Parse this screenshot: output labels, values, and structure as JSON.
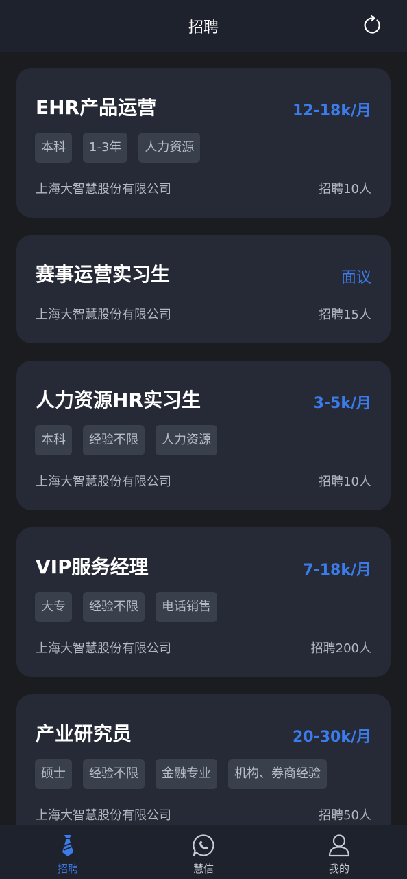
{
  "header": {
    "title": "招聘",
    "refresh_icon": "refresh-icon"
  },
  "jobs": [
    {
      "title": "EHR产品运营",
      "salary": "12-18k/月",
      "tags": [
        "本科",
        "1-3年",
        "人力资源"
      ],
      "company": "上海大智慧股份有限公司",
      "headcount": "招聘10人"
    },
    {
      "title": "赛事运营实习生",
      "salary": "面议",
      "tags": [],
      "company": "上海大智慧股份有限公司",
      "headcount": "招聘15人"
    },
    {
      "title": "人力资源HR实习生",
      "salary": "3-5k/月",
      "tags": [
        "本科",
        "经验不限",
        "人力资源"
      ],
      "company": "上海大智慧股份有限公司",
      "headcount": "招聘10人"
    },
    {
      "title": "VIP服务经理",
      "salary": "7-18k/月",
      "tags": [
        "大专",
        "经验不限",
        "电话销售"
      ],
      "company": "上海大智慧股份有限公司",
      "headcount": "招聘200人"
    },
    {
      "title": "产业研究员",
      "salary": "20-30k/月",
      "tags": [
        "硕士",
        "经验不限",
        "金融专业",
        "机构、券商经验"
      ],
      "company": "上海大智慧股份有限公司",
      "headcount": "招聘50人"
    }
  ],
  "nav": [
    {
      "label": "招聘",
      "icon": "tie-icon",
      "active": true
    },
    {
      "label": "慧信",
      "icon": "chat-icon",
      "active": false
    },
    {
      "label": "我的",
      "icon": "user-icon",
      "active": false
    }
  ],
  "colors": {
    "accent": "#3b7bea",
    "card": "#262a36",
    "tag": "#3a3f4c",
    "bar": "#1e222c",
    "background": "#1b1c1f"
  }
}
